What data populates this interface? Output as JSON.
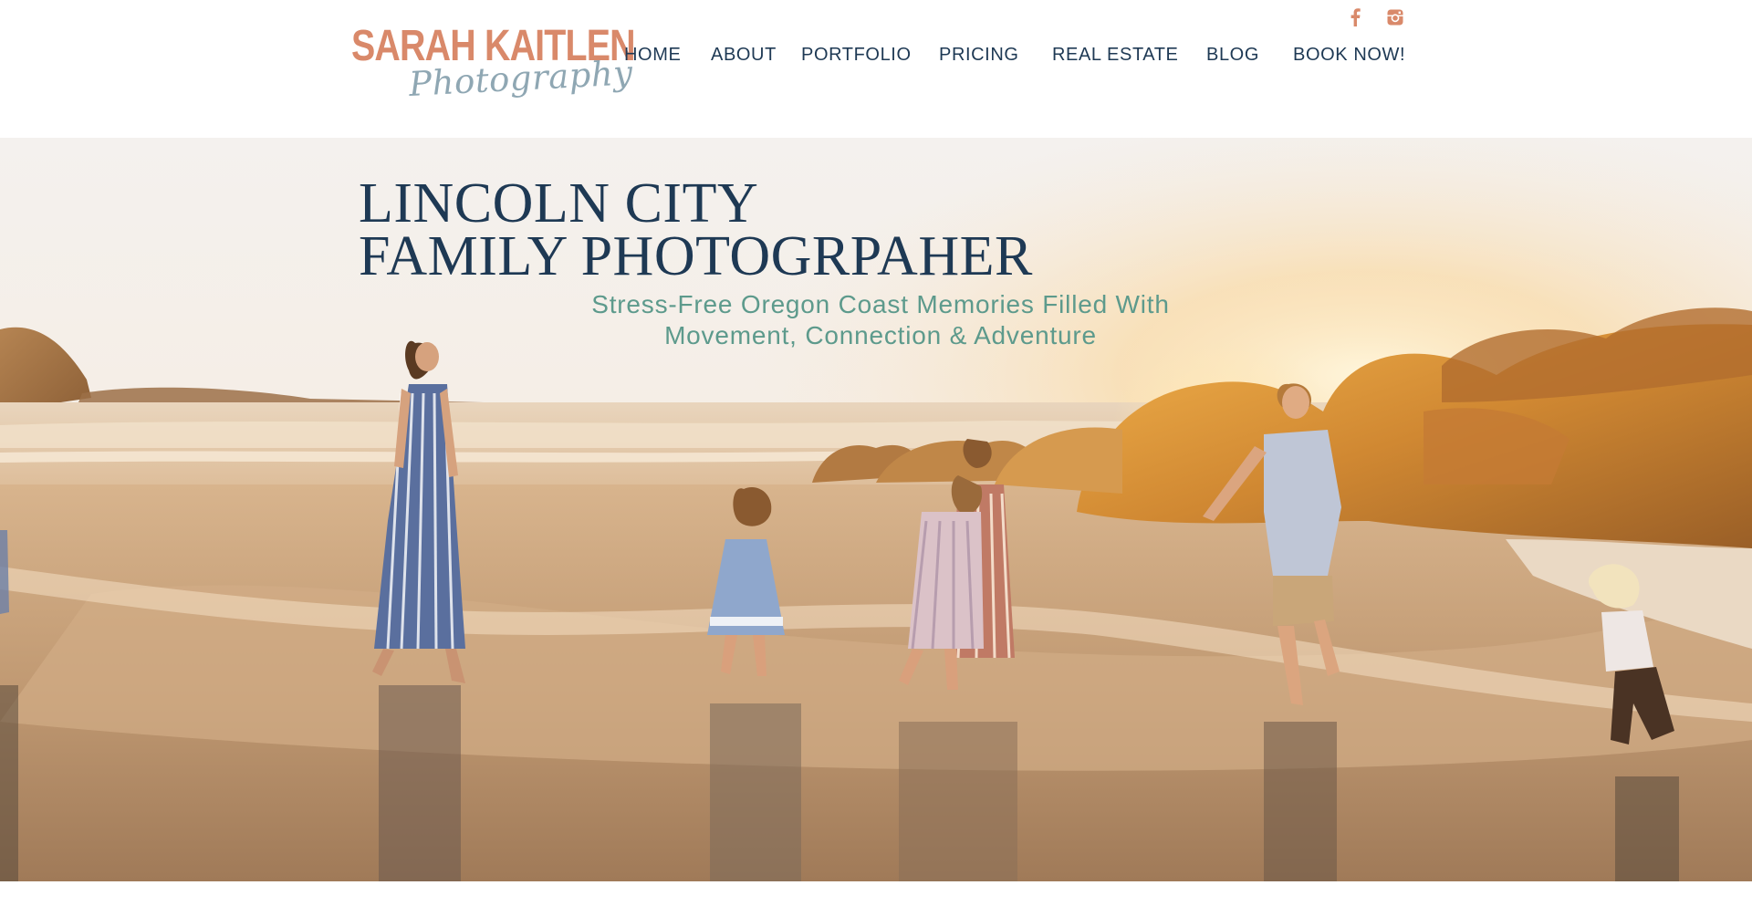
{
  "brand": {
    "name": "SARAH KAITLEN",
    "tagline": "Photography",
    "name_color": "#d9896a",
    "tagline_color": "#8fa7b3"
  },
  "nav": {
    "items": [
      {
        "label": "HOME"
      },
      {
        "label": "ABOUT"
      },
      {
        "label": "PORTFOLIO"
      },
      {
        "label": "PRICING"
      },
      {
        "label": "REAL ESTATE"
      },
      {
        "label": "BLOG"
      },
      {
        "label": "BOOK NOW!"
      }
    ],
    "color": "#1e3954"
  },
  "social": {
    "icons": [
      "facebook-icon",
      "instagram-icon"
    ],
    "color": "#d9896a"
  },
  "hero": {
    "title_line1": "LINCOLN CITY",
    "title_line2": "FAMILY PHOTOGRPAHER",
    "subtitle": "Stress-Free Oregon Coast Memories Filled With\nMovement, Connection  & Adventure",
    "title_color": "#1e3954",
    "subtitle_color": "#5d9a8c"
  }
}
